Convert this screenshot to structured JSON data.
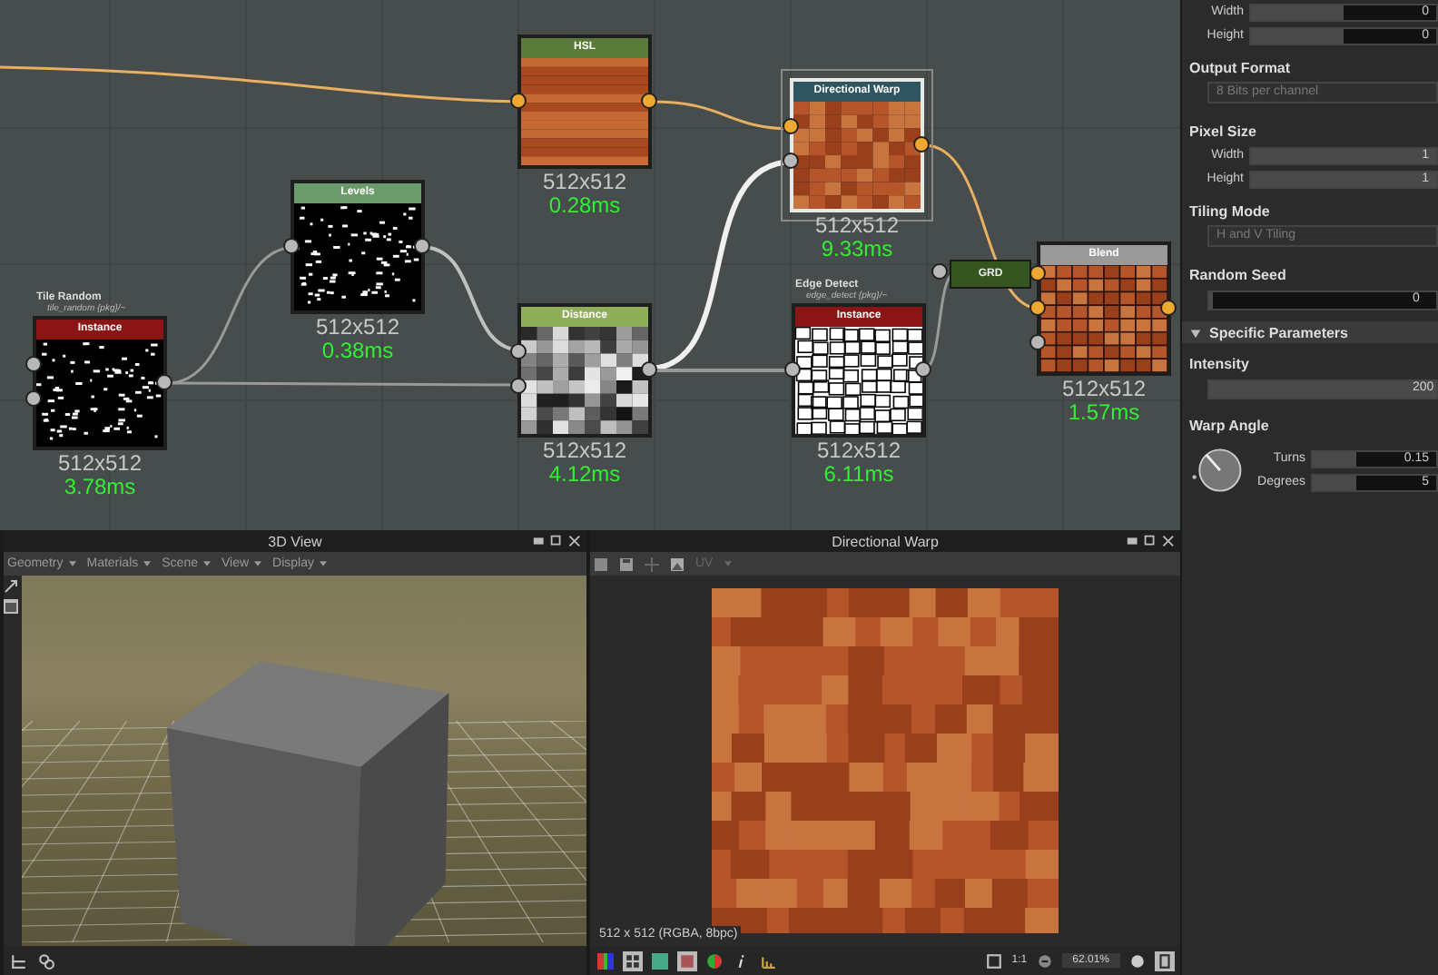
{
  "graph": {
    "nodes": [
      {
        "kind": "noise",
        "title": "Instance",
        "color": "#8b1515",
        "size": "512x512",
        "time": "3.78ms",
        "selected": false,
        "inputs": [
          {
            "kind": "gray"
          },
          {
            "kind": "gray"
          }
        ],
        "outputs": [
          {
            "kind": "gray"
          }
        ],
        "group": {
          "name": "Tile Random",
          "path": "tile_random {pkg}/~"
        }
      },
      {
        "kind": "noise",
        "title": "Levels",
        "color": "#6b9a6b",
        "size": "512x512",
        "time": "0.38ms",
        "selected": false,
        "inputs": [
          {
            "kind": "gray"
          }
        ],
        "outputs": [
          {
            "kind": "gray"
          }
        ]
      },
      {
        "kind": "wood",
        "title": "HSL",
        "color": "#5a7a3a",
        "size": "512x512",
        "time": "0.28ms",
        "selected": false,
        "inputs": [
          {
            "kind": "color"
          }
        ],
        "outputs": [
          {
            "kind": "color"
          }
        ]
      },
      {
        "kind": "cells",
        "title": "Distance",
        "color": "#8fae5a",
        "size": "512x512",
        "time": "4.12ms",
        "selected": false,
        "inputs": [
          {
            "kind": "gray"
          },
          {
            "kind": "gray"
          }
        ],
        "outputs": [
          {
            "kind": "gray"
          }
        ]
      },
      {
        "kind": "warp",
        "title": "Directional Warp",
        "color": "#2f5560",
        "size": "512x512",
        "time": "9.33ms",
        "selected": true,
        "inputs": [
          {
            "kind": "color"
          },
          {
            "kind": "gray"
          }
        ],
        "outputs": [
          {
            "kind": "color"
          }
        ]
      },
      {
        "kind": "edges",
        "title": "Instance",
        "color": "#8b1515",
        "size": "512x512",
        "time": "6.11ms",
        "selected": false,
        "inputs": [
          {
            "kind": "gray"
          }
        ],
        "outputs": [
          {
            "kind": "gray"
          }
        ],
        "group": {
          "name": "Edge Detect",
          "path": "edge_detect {pkg}/~"
        }
      },
      {
        "kind": "blend",
        "title": "Blend",
        "color": "#9a9a9a",
        "size": "512x512",
        "time": "1.57ms",
        "selected": false,
        "inputs": [
          {
            "kind": "color"
          },
          {
            "kind": "color"
          },
          {
            "kind": "gray"
          }
        ],
        "outputs": [
          {
            "kind": "color"
          }
        ]
      }
    ],
    "grd_node": {
      "label": "GRD"
    }
  },
  "parameters": [
    {
      "kind": "slider",
      "label": "Width",
      "value": "0",
      "level": 0.5
    },
    {
      "kind": "slider",
      "label": "Height",
      "value": "0",
      "level": 0.5
    },
    {
      "kind": "header",
      "label": "Output Format"
    },
    {
      "kind": "dropdown",
      "value": "8 Bits per channel",
      "disabled": true
    },
    {
      "kind": "header",
      "label": "Pixel Size"
    },
    {
      "kind": "slider",
      "label": "Width",
      "value": "1",
      "level": 1
    },
    {
      "kind": "slider",
      "label": "Height",
      "value": "1",
      "level": 1
    },
    {
      "kind": "header",
      "label": "Tiling Mode"
    },
    {
      "kind": "dropdown",
      "value": "H and V Tiling",
      "disabled": true
    },
    {
      "kind": "header",
      "label": "Random Seed"
    },
    {
      "kind": "wide_slider",
      "value": "0",
      "level": 0
    },
    {
      "kind": "section",
      "label": "Specific Parameters",
      "expanded": true
    },
    {
      "kind": "header",
      "label": "Intensity"
    },
    {
      "kind": "wide_slider",
      "value": "200",
      "level": 1
    },
    {
      "kind": "header",
      "label": "Warp Angle"
    },
    {
      "kind": "angle",
      "rows": [
        {
          "label": "Turns",
          "value": "0.15",
          "level": 0.35
        },
        {
          "label": "Degrees",
          "value": "5",
          "level": 0.35
        }
      ]
    }
  ],
  "view_3d": {
    "title": "3D View",
    "menus": [
      "Geometry",
      "Materials",
      "Scene",
      "View",
      "Display"
    ]
  },
  "view_2d": {
    "title": "Directional Warp",
    "uv_label": "UV",
    "image_info": "512 x 512 (RGBA, 8bpc)",
    "ratio_label": "1:1",
    "zoom": "62.01%"
  }
}
